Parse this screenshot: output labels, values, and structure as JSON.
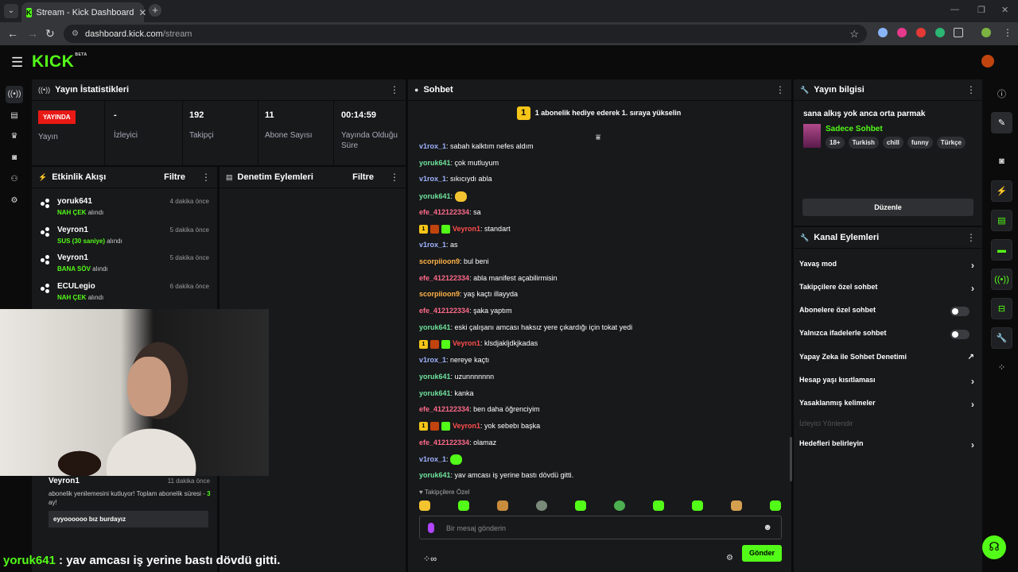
{
  "browser": {
    "tab_title": "Stream - Kick Dashboard",
    "url_host": "dashboard.kick.com",
    "url_path": "/stream"
  },
  "app": {
    "logo": "KICK",
    "logo_badge": "BETA"
  },
  "stats": {
    "title": "Yayın İstatistikleri",
    "live_badge": "YAYINDA",
    "live_label": "Yayın",
    "viewers_value": "-",
    "viewers_label": "İzleyici",
    "followers_value": "192",
    "followers_label": "Takipçi",
    "subs_value": "11",
    "subs_label": "Abone Sayısı",
    "uptime_value": "00:14:59",
    "uptime_label": "Yayında Olduğu Süre"
  },
  "activity": {
    "title": "Etkinlik Akışı",
    "filter": "Filtre",
    "suffix": "alındı",
    "items": [
      {
        "name": "yoruk641",
        "time": "4 dakika önce",
        "reward": "NAH ÇEK"
      },
      {
        "name": "Veyron1",
        "time": "5 dakika önce",
        "reward": "SUS (30 saniye)"
      },
      {
        "name": "Veyron1",
        "time": "5 dakika önce",
        "reward": "BANA SÖV"
      },
      {
        "name": "ECULegio",
        "time": "6 dakika önce",
        "reward": "NAH ÇEK"
      }
    ],
    "sub_event": {
      "name": "Veyron1",
      "time": "11 dakika önce",
      "desc_before": "abonelik yenilemesini kutluyor! Toplam abonelik süresi - ",
      "months": "3",
      "desc_after": " ay!",
      "message": "eyyoooooo bız burdayız"
    }
  },
  "moderation": {
    "title": "Denetim Eylemleri",
    "filter": "Filtre"
  },
  "caption": {
    "user": "yoruk641",
    "text": " : yav amcası iş yerine bastı dövdü gitti."
  },
  "chat": {
    "title": "Sohbet",
    "pinned_rank": "1",
    "pinned_text": "1 abonelik hediye ederek 1. sıraya yükselin",
    "messages": [
      {
        "user": "v1rox_1",
        "color": "#9fb3ff",
        "text": "sabah kalktım nefes aldım"
      },
      {
        "user": "yoruk641",
        "color": "#6fe39c",
        "text": "çok mutluyum"
      },
      {
        "user": "v1rox_1",
        "color": "#9fb3ff",
        "text": "sıkıcıydı abla"
      },
      {
        "user": "yoruk641",
        "color": "#6fe39c",
        "text": ""
      },
      {
        "user": "efe_412122334",
        "color": "#ff6b8a",
        "text": "sa"
      },
      {
        "user": "Veyron1",
        "color": "#ff4d4d",
        "text": "standart"
      },
      {
        "user": "v1rox_1",
        "color": "#9fb3ff",
        "text": "as"
      },
      {
        "user": "scorpiioon9",
        "color": "#ffb347",
        "text": "bul beni"
      },
      {
        "user": "efe_412122334",
        "color": "#ff6b8a",
        "text": "abla manifest açabilirmisin"
      },
      {
        "user": "scorpiioon9",
        "color": "#ffb347",
        "text": "yaş kaçtı illayyda"
      },
      {
        "user": "efe_412122334",
        "color": "#ff6b8a",
        "text": "şaka yaptım"
      },
      {
        "user": "yoruk641",
        "color": "#6fe39c",
        "text": "eski çalışanı amcası haksız yere çıkardığı için tokat yedi"
      },
      {
        "user": "Veyron1",
        "color": "#ff4d4d",
        "text": "klsdjakljdkjkadas"
      },
      {
        "user": "v1rox_1",
        "color": "#9fb3ff",
        "text": "nereye kaçtı"
      },
      {
        "user": "yoruk641",
        "color": "#6fe39c",
        "text": "uzunnnnnnn"
      },
      {
        "user": "yoruk641",
        "color": "#6fe39c",
        "text": "kanka"
      },
      {
        "user": "efe_412122334",
        "color": "#ff6b8a",
        "text": "ben daha öğrenciyim"
      },
      {
        "user": "Veyron1",
        "color": "#ff4d4d",
        "text": "yok sebebı başka"
      },
      {
        "user": "efe_412122334",
        "color": "#ff6b8a",
        "text": "olamaz"
      },
      {
        "user": "v1rox_1",
        "color": "#9fb3ff",
        "text": ""
      },
      {
        "user": "yoruk641",
        "color": "#6fe39c",
        "text": "yav amcası iş yerine bastı dövdü gitti."
      }
    ],
    "follow_only": "Takipçilere Özel",
    "placeholder": "Bir mesaj gönderin",
    "send": "Gönder"
  },
  "stream_info": {
    "title": "Yayın bilgisi",
    "stream_title": "sana alkış yok anca orta parmak",
    "category": "Sadece Sohbet",
    "tags": [
      "18+",
      "Turkish",
      "chill",
      "funny",
      "Türkçe"
    ],
    "edit": "Düzenle"
  },
  "channel_actions": {
    "title": "Kanal Eylemleri",
    "slow_mode": "Yavaş mod",
    "followers_only": "Takipçilere özel sohbet",
    "subs_only": "Abonelere özel sohbet",
    "emotes_only": "Yalnızca ifadelerle sohbet",
    "ai_mod": "Yapay Zeka ile Sohbet Denetimi",
    "account_age": "Hesap yaşı kısıtlaması",
    "banned_words": "Yasaklanmış kelimeler",
    "viewer_redirect": "İzleyici Yönlendir",
    "set_goals": "Hedefleri belirleyin"
  }
}
